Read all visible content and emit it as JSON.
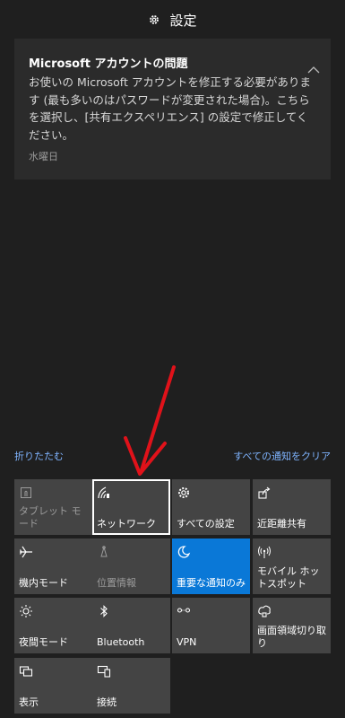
{
  "header": {
    "title": "設定",
    "icon": "gear-icon"
  },
  "notification": {
    "title": "Microsoft アカウントの問題",
    "body": "お使いの Microsoft アカウントを修正する必要があります (最も多いのはパスワードが変更された場合)。こちらを選択し、[共有エクスペリエンス] の設定で修正してください。",
    "time": "水曜日"
  },
  "actions": {
    "collapse": "折りたたむ",
    "clear_all": "すべての通知をクリア"
  },
  "tiles": [
    {
      "label": "タブレット モード",
      "icon": "tablet-mode-icon"
    },
    {
      "label": "ネットワーク",
      "icon": "network-icon"
    },
    {
      "label": "すべての設定",
      "icon": "gear-icon"
    },
    {
      "label": "近距離共有",
      "icon": "nearby-share-icon"
    },
    {
      "label": "機内モード",
      "icon": "airplane-icon"
    },
    {
      "label": "位置情報",
      "icon": "location-icon"
    },
    {
      "label": "重要な通知のみ",
      "icon": "moon-icon"
    },
    {
      "label": "モバイル ホットスポット",
      "icon": "hotspot-icon"
    },
    {
      "label": "夜間モード",
      "icon": "night-light-icon"
    },
    {
      "label": "Bluetooth",
      "icon": "bluetooth-icon"
    },
    {
      "label": "VPN",
      "icon": "vpn-icon"
    },
    {
      "label": "画面領域切り取り",
      "icon": "snip-icon"
    },
    {
      "label": "表示",
      "icon": "project-icon"
    },
    {
      "label": "接続",
      "icon": "connect-icon"
    }
  ],
  "colors": {
    "accent": "#0a78d7",
    "tile": "#444444",
    "background": "#1f1f1f",
    "link": "#7fb4ff",
    "annotation": "#e0121a"
  }
}
